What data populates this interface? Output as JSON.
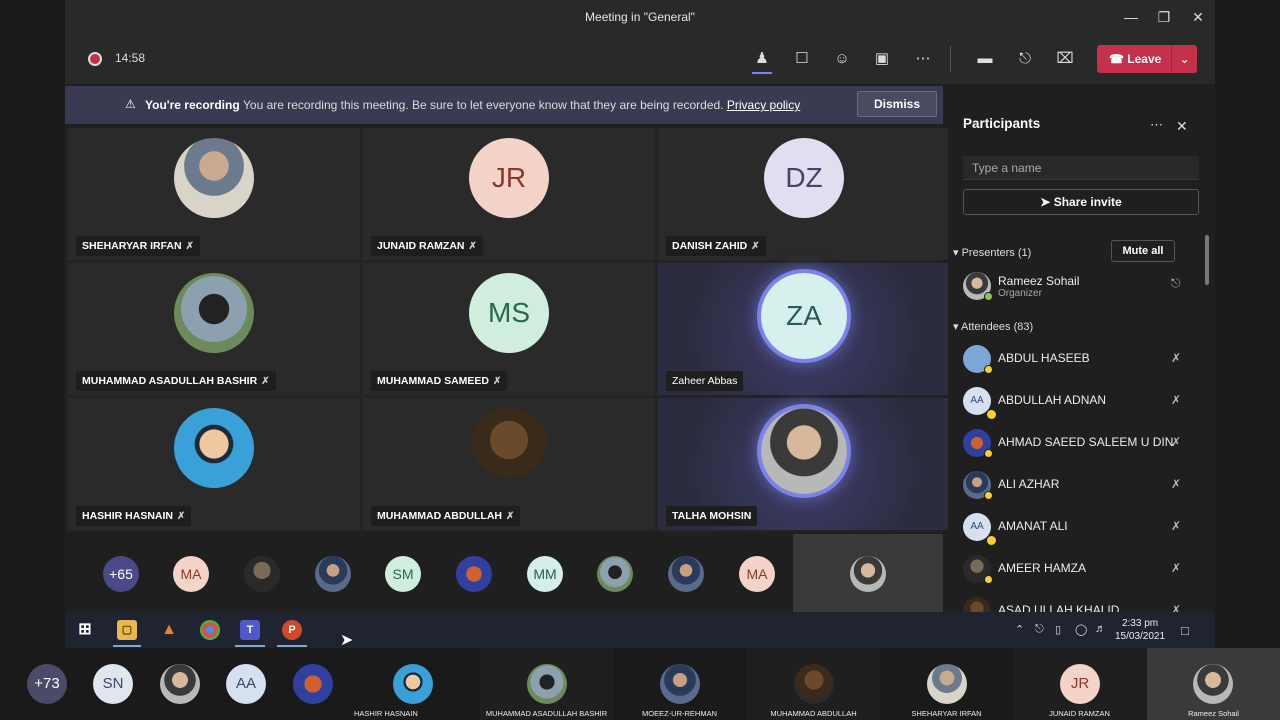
{
  "window": {
    "title": "Meeting in \"General\""
  },
  "toolbar": {
    "timer": "14:58",
    "leave_label": "Leave"
  },
  "banner": {
    "title": "You're recording",
    "message": "You are recording this meeting. Be sure to let everyone know that they are being recorded.",
    "policy_link": "Privacy policy",
    "dismiss_label": "Dismiss"
  },
  "grid": [
    {
      "name": "SHEHARYAR IRFAN",
      "initials": "",
      "avatar_bg": "#8a8a8a"
    },
    {
      "name": "JUNAID RAMZAN",
      "initials": "JR",
      "avatar_bg": "#f4d3c8"
    },
    {
      "name": "DANISH ZAHID",
      "initials": "DZ",
      "avatar_bg": "#e0def0"
    },
    {
      "name": "MUHAMMAD ASADULLAH BASHIR",
      "initials": "",
      "avatar_bg": "#8ca0b0"
    },
    {
      "name": "MUHAMMAD SAMEED",
      "initials": "MS",
      "avatar_bg": "#cfeedd"
    },
    {
      "name": "Zaheer Abbas",
      "initials": "ZA",
      "avatar_bg": "#d6f0ee"
    },
    {
      "name": "HASHIR HASNAIN",
      "initials": "",
      "avatar_bg": "#3aa0d8"
    },
    {
      "name": "MUHAMMAD ABDULLAH",
      "initials": "",
      "avatar_bg": "#6a4a2a"
    },
    {
      "name": "TALHA MOHSIN",
      "initials": "",
      "avatar_bg": "#d8b89a"
    }
  ],
  "strip": [
    "+65",
    "MA",
    "",
    "",
    "SM",
    "",
    "MM",
    "",
    "",
    "MA"
  ],
  "panel": {
    "title": "Participants",
    "search_placeholder": "Type a name",
    "share_label": "Share invite",
    "presenters_label": "Presenters (1)",
    "mute_all_label": "Mute all",
    "attendees_label": "Attendees (83)",
    "presenter": {
      "name": "Rameez Sohail",
      "role": "Organizer"
    },
    "attendees": [
      {
        "name": "ABDUL HASEEB",
        "initials": ""
      },
      {
        "name": "ABDULLAH ADNAN",
        "initials": "AA"
      },
      {
        "name": "AHMAD SAEED SALEEM U DIN",
        "initials": ""
      },
      {
        "name": "ALI AZHAR",
        "initials": ""
      },
      {
        "name": "AMANAT ALI",
        "initials": "AA"
      },
      {
        "name": "AMEER HAMZA",
        "initials": ""
      },
      {
        "name": "ASAD ULLAH KHALID",
        "initials": ""
      }
    ]
  },
  "taskbar": {
    "clock_time": "2:33 pm",
    "clock_date": "15/03/2021"
  },
  "bottom_strip": {
    "bubbles": [
      "+73",
      "SN",
      "",
      "AA",
      ""
    ],
    "tiles": [
      {
        "label": "HASHIR HASNAIN",
        "initials": ""
      },
      {
        "label": "MUHAMMAD ASADULLAH BASHIR",
        "initials": ""
      },
      {
        "label": "MOEEZ-UR-REHMAN",
        "initials": ""
      },
      {
        "label": "MUHAMMAD ABDULLAH",
        "initials": ""
      },
      {
        "label": "SHEHARYAR IRFAN",
        "initials": ""
      },
      {
        "label": "JUNAID RAMZAN",
        "initials": "JR"
      },
      {
        "label": "Rameez Sohail",
        "initials": ""
      }
    ]
  },
  "colors": {
    "accent": "#7b83eb",
    "leave": "#c4314b",
    "banner": "#3a3a52",
    "presence_away": "#f8d22a"
  }
}
